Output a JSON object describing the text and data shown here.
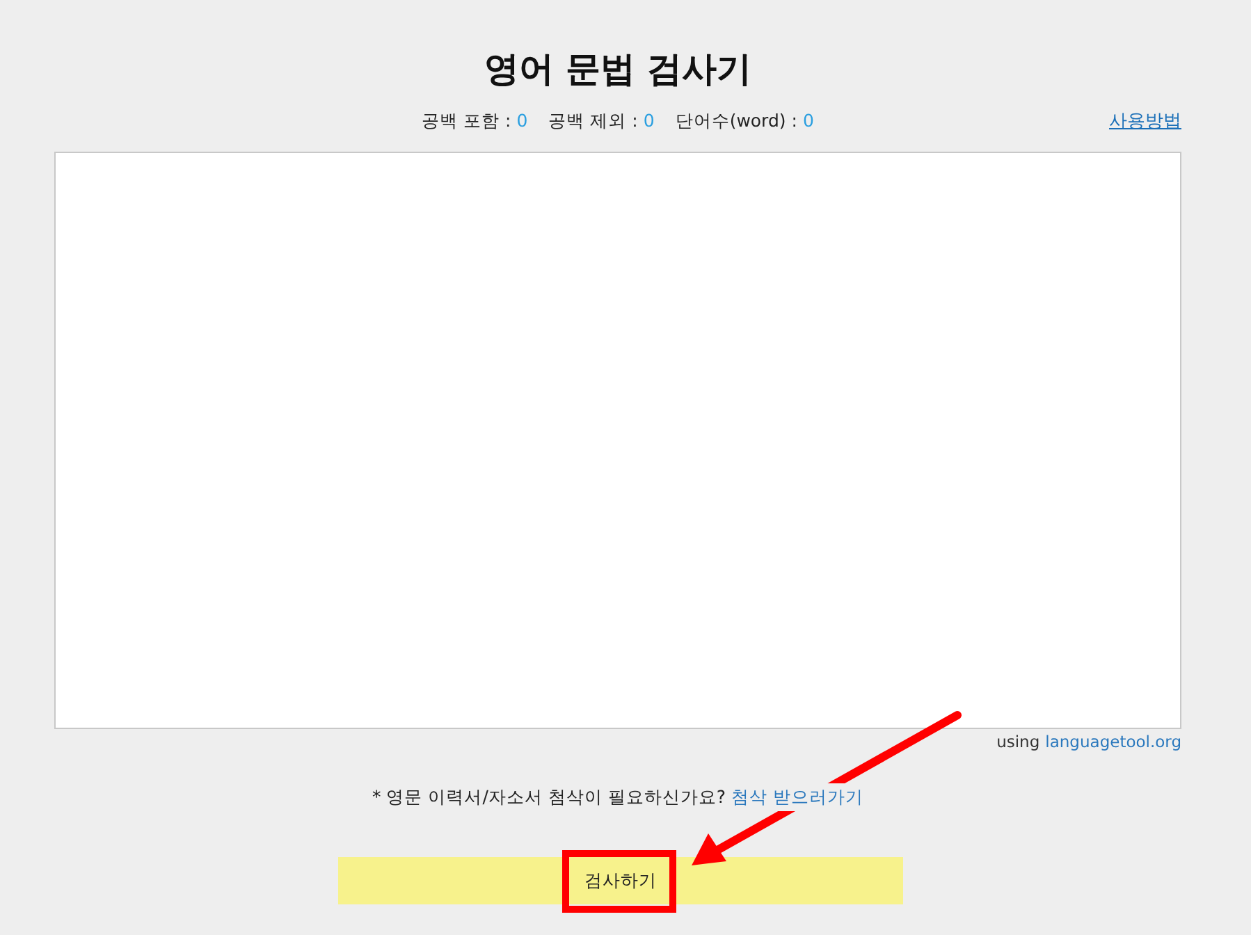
{
  "title": "영어 문법 검사기",
  "counts": [
    {
      "label": "공백 포함 :",
      "value": "0"
    },
    {
      "label": "공백 제외 :",
      "value": "0"
    },
    {
      "label": "단어수(word) :",
      "value": "0"
    }
  ],
  "help_link": "사용방법",
  "editor": {
    "credit_prefix": "using",
    "credit_link": "languagetool.org"
  },
  "note": {
    "text": "* 영문 이력서/자소서 첨삭이 필요하신가요?",
    "link": "첨삭 받으러가기"
  },
  "submit_button": "검사하기",
  "annotation_arrow": true,
  "highlight_frame": true
}
